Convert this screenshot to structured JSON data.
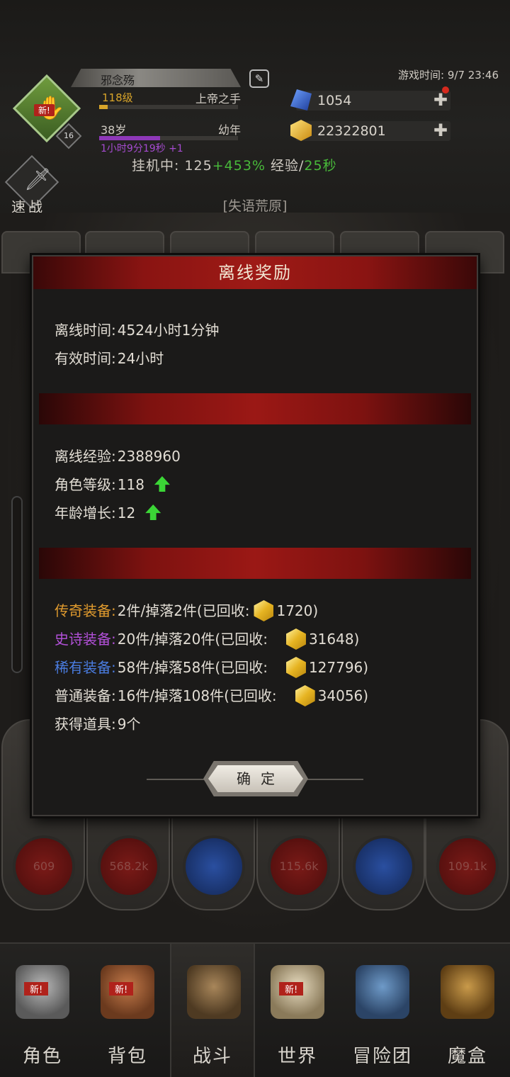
{
  "header": {
    "player_name": "邪念殇",
    "level": "118级",
    "title": "上帝之手",
    "age": "38岁",
    "age_stage": "幼年",
    "age_timer": "1小时9分19秒 +1",
    "emblem_level": "16",
    "new_badge": "新!",
    "game_time": "游戏时间: 9/7 23:46",
    "diamonds": "1054",
    "gold": "22322801",
    "idle_prefix": "挂机中: 125",
    "idle_bonus": "+453%",
    "idle_exp": " 经验/",
    "idle_interval": "25秒",
    "quick_battle": "速战",
    "location": "[失语荒原]"
  },
  "colors": {
    "accent_red": "#9e1a16",
    "legend": "#e19b2e",
    "epic": "#b250d8",
    "rare": "#4a7ce0",
    "green": "#48b93a"
  },
  "background": {
    "skill_values": [
      "609",
      "568.2k",
      "",
      "115.6k",
      "",
      "109.1k"
    ]
  },
  "modal": {
    "title": "离线奖励",
    "offline_time_label": "离线时间:",
    "offline_time_value": "4524小时1分钟",
    "effective_time_label": "有效时间:",
    "effective_time_value": "24小时",
    "exp_label": "离线经验:",
    "exp_value": "2388960",
    "char_level_label": "角色等级:",
    "char_level_value": "118",
    "age_growth_label": "年龄增长:",
    "age_growth_value": "12",
    "legend_label": "传奇装备:",
    "legend_value": "2件/掉落2件(已回收:",
    "legend_gold": "1720)",
    "epic_label": "史诗装备:",
    "epic_value": "20件/掉落20件(已回收:",
    "epic_gold": "31648)",
    "rare_label": "稀有装备:",
    "rare_value": "58件/掉落58件(已回收:",
    "rare_gold": "127796)",
    "common_label": "普通装备:",
    "common_value": "16件/掉落108件(已回收:",
    "common_gold": "34056)",
    "items_label": "获得道具:",
    "items_value": "9个",
    "ok_label": "确定"
  },
  "nav": {
    "items": [
      {
        "label": "角色",
        "icon": "helmet-icon",
        "new": "新!"
      },
      {
        "label": "背包",
        "icon": "backpack-icon",
        "new": "新!"
      },
      {
        "label": "战斗",
        "icon": "shield-sword-icon",
        "new": ""
      },
      {
        "label": "世界",
        "icon": "scroll-map-icon",
        "new": "新!"
      },
      {
        "label": "冒险团",
        "icon": "castle-icon",
        "new": ""
      },
      {
        "label": "魔盒",
        "icon": "magic-box-icon",
        "new": ""
      }
    ]
  }
}
